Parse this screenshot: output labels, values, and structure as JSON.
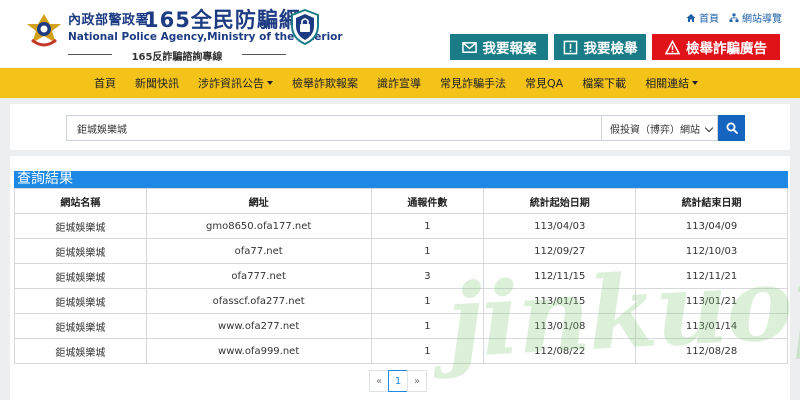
{
  "header": {
    "agency_name": "內政部警政署",
    "site_name": "165全民防騙網",
    "agency_english": "National Police Agency,Ministry of the Interior",
    "hotline": "165反詐騙諮詢專線",
    "top_links": {
      "home": "首頁",
      "sitemap": "網站導覽"
    },
    "actions": {
      "report": "我要報案",
      "check": "我要檢舉",
      "fraud_ad": "檢舉詐騙廣告"
    },
    "colors": {
      "brand": "#1d3b82",
      "action_teal": "#1a7c86",
      "action_red": "#e0131b"
    }
  },
  "nav": {
    "items": [
      {
        "label": "首頁",
        "dropdown": false
      },
      {
        "label": "新聞快訊",
        "dropdown": false
      },
      {
        "label": "涉詐資訊公告",
        "dropdown": true
      },
      {
        "label": "檢舉詐欺報案",
        "dropdown": false
      },
      {
        "label": "識詐宣導",
        "dropdown": false
      },
      {
        "label": "常見詐騙手法",
        "dropdown": false
      },
      {
        "label": "常見QA",
        "dropdown": false
      },
      {
        "label": "檔案下載",
        "dropdown": false
      },
      {
        "label": "相關連結",
        "dropdown": true
      }
    ],
    "color": "#f3c31a"
  },
  "search": {
    "value": "鉅城娛樂城",
    "category": "假投資（博弈）網站"
  },
  "results": {
    "title": "查詢結果",
    "columns": [
      "網站名稱",
      "網址",
      "通報件數",
      "統計起始日期",
      "統計結束日期"
    ],
    "rows": [
      {
        "name": "鉅城娛樂城",
        "url": "gmo8650.ofa177.net",
        "count": "1",
        "start": "113/04/03",
        "end": "113/04/09"
      },
      {
        "name": "鉅城娛樂城",
        "url": "ofa77.net",
        "count": "1",
        "start": "112/09/27",
        "end": "112/10/03"
      },
      {
        "name": "鉅城娛樂城",
        "url": "ofa777.net",
        "count": "3",
        "start": "112/11/15",
        "end": "112/11/21"
      },
      {
        "name": "鉅城娛樂城",
        "url": "ofasscf.ofa277.net",
        "count": "1",
        "start": "113/01/15",
        "end": "113/01/21"
      },
      {
        "name": "鉅城娛樂城",
        "url": "www.ofa277.net",
        "count": "1",
        "start": "113/01/08",
        "end": "113/01/14"
      },
      {
        "name": "鉅城娛樂城",
        "url": "www.ofa999.net",
        "count": "1",
        "start": "112/08/22",
        "end": "112/08/28"
      }
    ],
    "title_color": "#1e88e5"
  },
  "pagination": {
    "prev": "«",
    "current": "1",
    "next": "»"
  },
  "watermark": {
    "text": "jinkuopa"
  }
}
